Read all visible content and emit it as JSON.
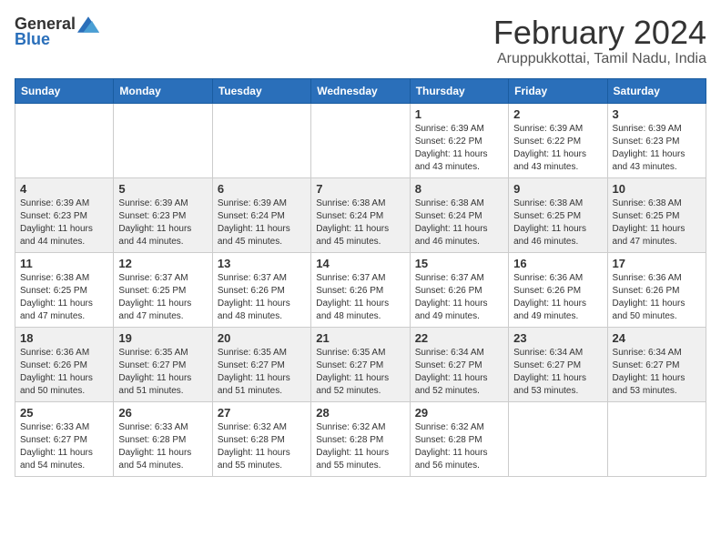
{
  "logo": {
    "general": "General",
    "blue": "Blue"
  },
  "title": "February 2024",
  "subtitle": "Aruppukkottai, Tamil Nadu, India",
  "days_of_week": [
    "Sunday",
    "Monday",
    "Tuesday",
    "Wednesday",
    "Thursday",
    "Friday",
    "Saturday"
  ],
  "weeks": [
    [
      {
        "day": "",
        "info": ""
      },
      {
        "day": "",
        "info": ""
      },
      {
        "day": "",
        "info": ""
      },
      {
        "day": "",
        "info": ""
      },
      {
        "day": "1",
        "sunrise": "6:39 AM",
        "sunset": "6:22 PM",
        "daylight": "11 hours and 43 minutes."
      },
      {
        "day": "2",
        "sunrise": "6:39 AM",
        "sunset": "6:22 PM",
        "daylight": "11 hours and 43 minutes."
      },
      {
        "day": "3",
        "sunrise": "6:39 AM",
        "sunset": "6:23 PM",
        "daylight": "11 hours and 43 minutes."
      }
    ],
    [
      {
        "day": "4",
        "sunrise": "6:39 AM",
        "sunset": "6:23 PM",
        "daylight": "11 hours and 44 minutes."
      },
      {
        "day": "5",
        "sunrise": "6:39 AM",
        "sunset": "6:23 PM",
        "daylight": "11 hours and 44 minutes."
      },
      {
        "day": "6",
        "sunrise": "6:39 AM",
        "sunset": "6:24 PM",
        "daylight": "11 hours and 45 minutes."
      },
      {
        "day": "7",
        "sunrise": "6:38 AM",
        "sunset": "6:24 PM",
        "daylight": "11 hours and 45 minutes."
      },
      {
        "day": "8",
        "sunrise": "6:38 AM",
        "sunset": "6:24 PM",
        "daylight": "11 hours and 46 minutes."
      },
      {
        "day": "9",
        "sunrise": "6:38 AM",
        "sunset": "6:25 PM",
        "daylight": "11 hours and 46 minutes."
      },
      {
        "day": "10",
        "sunrise": "6:38 AM",
        "sunset": "6:25 PM",
        "daylight": "11 hours and 47 minutes."
      }
    ],
    [
      {
        "day": "11",
        "sunrise": "6:38 AM",
        "sunset": "6:25 PM",
        "daylight": "11 hours and 47 minutes."
      },
      {
        "day": "12",
        "sunrise": "6:37 AM",
        "sunset": "6:25 PM",
        "daylight": "11 hours and 47 minutes."
      },
      {
        "day": "13",
        "sunrise": "6:37 AM",
        "sunset": "6:26 PM",
        "daylight": "11 hours and 48 minutes."
      },
      {
        "day": "14",
        "sunrise": "6:37 AM",
        "sunset": "6:26 PM",
        "daylight": "11 hours and 48 minutes."
      },
      {
        "day": "15",
        "sunrise": "6:37 AM",
        "sunset": "6:26 PM",
        "daylight": "11 hours and 49 minutes."
      },
      {
        "day": "16",
        "sunrise": "6:36 AM",
        "sunset": "6:26 PM",
        "daylight": "11 hours and 49 minutes."
      },
      {
        "day": "17",
        "sunrise": "6:36 AM",
        "sunset": "6:26 PM",
        "daylight": "11 hours and 50 minutes."
      }
    ],
    [
      {
        "day": "18",
        "sunrise": "6:36 AM",
        "sunset": "6:26 PM",
        "daylight": "11 hours and 50 minutes."
      },
      {
        "day": "19",
        "sunrise": "6:35 AM",
        "sunset": "6:27 PM",
        "daylight": "11 hours and 51 minutes."
      },
      {
        "day": "20",
        "sunrise": "6:35 AM",
        "sunset": "6:27 PM",
        "daylight": "11 hours and 51 minutes."
      },
      {
        "day": "21",
        "sunrise": "6:35 AM",
        "sunset": "6:27 PM",
        "daylight": "11 hours and 52 minutes."
      },
      {
        "day": "22",
        "sunrise": "6:34 AM",
        "sunset": "6:27 PM",
        "daylight": "11 hours and 52 minutes."
      },
      {
        "day": "23",
        "sunrise": "6:34 AM",
        "sunset": "6:27 PM",
        "daylight": "11 hours and 53 minutes."
      },
      {
        "day": "24",
        "sunrise": "6:34 AM",
        "sunset": "6:27 PM",
        "daylight": "11 hours and 53 minutes."
      }
    ],
    [
      {
        "day": "25",
        "sunrise": "6:33 AM",
        "sunset": "6:27 PM",
        "daylight": "11 hours and 54 minutes."
      },
      {
        "day": "26",
        "sunrise": "6:33 AM",
        "sunset": "6:28 PM",
        "daylight": "11 hours and 54 minutes."
      },
      {
        "day": "27",
        "sunrise": "6:32 AM",
        "sunset": "6:28 PM",
        "daylight": "11 hours and 55 minutes."
      },
      {
        "day": "28",
        "sunrise": "6:32 AM",
        "sunset": "6:28 PM",
        "daylight": "11 hours and 55 minutes."
      },
      {
        "day": "29",
        "sunrise": "6:32 AM",
        "sunset": "6:28 PM",
        "daylight": "11 hours and 56 minutes."
      },
      {
        "day": "",
        "info": ""
      },
      {
        "day": "",
        "info": ""
      }
    ]
  ],
  "labels": {
    "sunrise": "Sunrise:",
    "sunset": "Sunset:",
    "daylight": "Daylight:"
  }
}
